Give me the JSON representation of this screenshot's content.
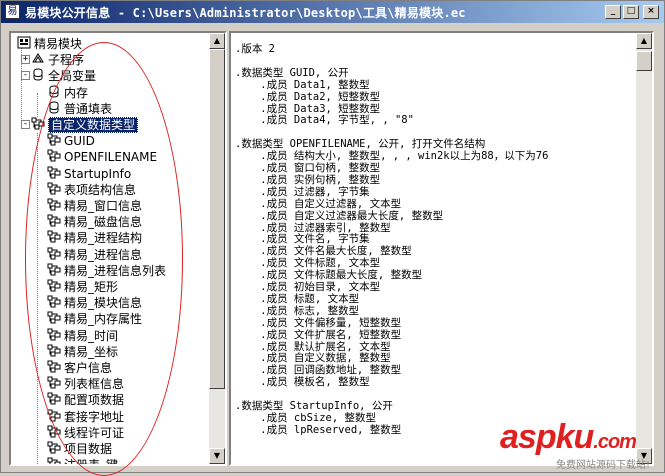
{
  "window": {
    "title": "易模块公开信息 - C:\\Users\\Administrator\\Desktop\\工具\\精易模块.ec",
    "buttons": {
      "minimize": "_",
      "maximize": "□",
      "close": "×"
    }
  },
  "tree": {
    "nodes": [
      {
        "label": "精易模块",
        "icon": "module-icon",
        "level": 0,
        "expander": "-"
      },
      {
        "label": "子程序",
        "icon": "subroutine-icon",
        "level": 1,
        "expander": "+"
      },
      {
        "label": "全局变量",
        "icon": "global-var-icon",
        "level": 1,
        "expander": "-"
      },
      {
        "label": "内存",
        "icon": "var-icon",
        "level": 2
      },
      {
        "label": "普通填表",
        "icon": "var-icon",
        "level": 2
      },
      {
        "label": "自定义数据类型",
        "icon": "datatype-folder-icon",
        "level": 1,
        "expander": "-",
        "selected": true
      },
      {
        "label": "GUID",
        "icon": "datatype-icon",
        "level": 2
      },
      {
        "label": "OPENFILENAME",
        "icon": "datatype-icon",
        "level": 2
      },
      {
        "label": "StartupInfo",
        "icon": "datatype-icon",
        "level": 2
      },
      {
        "label": "表项结构信息",
        "icon": "datatype-icon",
        "level": 2
      },
      {
        "label": "精易_窗口信息",
        "icon": "datatype-icon",
        "level": 2
      },
      {
        "label": "精易_磁盘信息",
        "icon": "datatype-icon",
        "level": 2
      },
      {
        "label": "精易_进程结构",
        "icon": "datatype-icon",
        "level": 2
      },
      {
        "label": "精易_进程信息",
        "icon": "datatype-icon",
        "level": 2
      },
      {
        "label": "精易_进程信息列表",
        "icon": "datatype-icon",
        "level": 2
      },
      {
        "label": "精易_矩形",
        "icon": "datatype-icon",
        "level": 2
      },
      {
        "label": "精易_模块信息",
        "icon": "datatype-icon",
        "level": 2
      },
      {
        "label": "精易_内存属性",
        "icon": "datatype-icon",
        "level": 2
      },
      {
        "label": "精易_时间",
        "icon": "datatype-icon",
        "level": 2
      },
      {
        "label": "精易_坐标",
        "icon": "datatype-icon",
        "level": 2
      },
      {
        "label": "客户信息",
        "icon": "datatype-icon",
        "level": 2
      },
      {
        "label": "列表框信息",
        "icon": "datatype-icon",
        "level": 2
      },
      {
        "label": "配置项数据",
        "icon": "datatype-icon",
        "level": 2
      },
      {
        "label": "套接字地址",
        "icon": "datatype-icon",
        "level": 2
      },
      {
        "label": "线程许可证",
        "icon": "datatype-icon",
        "level": 2
      },
      {
        "label": "项目数据",
        "icon": "datatype-icon",
        "level": 2
      },
      {
        "label": "注册表_键",
        "icon": "datatype-icon",
        "level": 2
      }
    ]
  },
  "code": {
    "lines": [
      ".版本 2",
      "",
      ".数据类型 GUID, 公开",
      "    .成员 Data1, 整数型",
      "    .成员 Data2, 短整数型",
      "    .成员 Data3, 短整数型",
      "    .成员 Data4, 字节型, , \"8\"",
      "",
      ".数据类型 OPENFILENAME, 公开, 打开文件名结构",
      "    .成员 结构大小, 整数型, , , win2k以上为88，以下为76",
      "    .成员 窗口句柄, 整数型",
      "    .成员 实例句柄, 整数型",
      "    .成员 过滤器, 字节集",
      "    .成员 自定义过滤器, 文本型",
      "    .成员 自定义过滤器最大长度, 整数型",
      "    .成员 过滤器索引, 整数型",
      "    .成员 文件名, 字节集",
      "    .成员 文件名最大长度, 整数型",
      "    .成员 文件标题, 文本型",
      "    .成员 文件标题最大长度, 整数型",
      "    .成员 初始目录, 文本型",
      "    .成员 标题, 文本型",
      "    .成员 标志, 整数型",
      "    .成员 文件偏移量, 短整数型",
      "    .成员 文件扩展名, 短整数型",
      "    .成员 默认扩展名, 文本型",
      "    .成员 自定义数据, 整数型",
      "    .成员 回调函数地址, 整数型",
      "    .成员 模板名, 整数型",
      "",
      ".数据类型 StartupInfo, 公开",
      "    .成员 cbSize, 整数型",
      "    .成员 lpReserved, 整数型"
    ]
  },
  "watermark": {
    "brand": "aspku",
    "tld": ".com",
    "caption": "免费网站源码下载站!"
  },
  "colors": {
    "titlebar": "#0a246a",
    "selection": "#0a246a",
    "annotation": "#d22222",
    "watermark": "#e02020"
  }
}
